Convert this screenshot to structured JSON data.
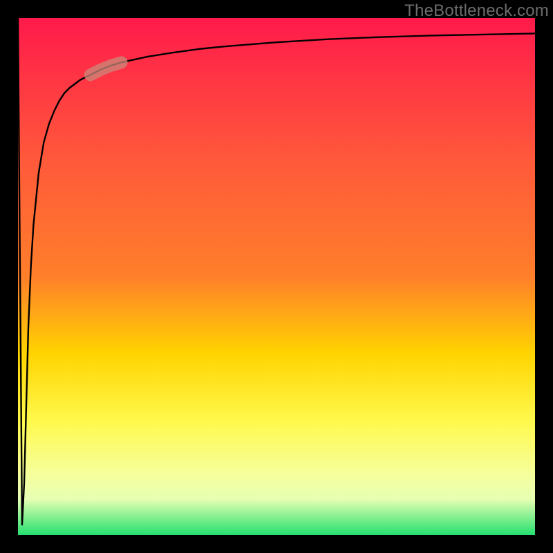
{
  "watermark": "TheBottleneck.com",
  "colors": {
    "border": "#000000",
    "top": "#ff1a4b",
    "mid1": "#ff7f2a",
    "mid2": "#ffd400",
    "mid3": "#fff94d",
    "bottom_light": "#e7ffb3",
    "bottom": "#24e06f",
    "curve": "#000000",
    "highlight": "#c98a7a"
  },
  "chart_data": {
    "type": "line",
    "title": "",
    "xlabel": "",
    "ylabel": "",
    "xlim": [
      0,
      100
    ],
    "ylim": [
      0,
      100
    ],
    "grid": false,
    "annotations": [
      "TheBottleneck.com"
    ],
    "series": [
      {
        "name": "curve",
        "x": [
          0.0,
          0.8,
          1.2,
          1.6,
          2.0,
          2.5,
          3.0,
          4.0,
          5.0,
          6.0,
          7.0,
          8.0,
          9.0,
          10.0,
          12.0,
          14.0,
          16.0,
          18.0,
          20.0,
          25.0,
          30.0,
          35.0,
          40.0,
          50.0,
          60.0,
          70.0,
          80.0,
          90.0,
          100.0
        ],
        "values": [
          100.0,
          2.0,
          10.0,
          25.0,
          40.0,
          52.0,
          60.0,
          70.0,
          76.0,
          79.5,
          82.0,
          84.0,
          85.5,
          86.5,
          88.0,
          89.0,
          90.0,
          90.8,
          91.4,
          92.5,
          93.3,
          94.0,
          94.5,
          95.3,
          95.9,
          96.3,
          96.6,
          96.8,
          97.0
        ]
      }
    ],
    "highlight_segment": {
      "x_start": 14.0,
      "x_end": 22.0
    }
  }
}
